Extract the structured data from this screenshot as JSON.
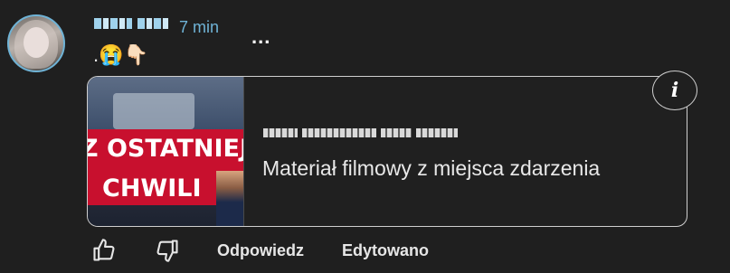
{
  "comment": {
    "time": "7 min",
    "more_label": "...",
    "emojis": ".😭👇🏻"
  },
  "link_card": {
    "thumbnail_text_line1": "Z OSTATNIEJ",
    "thumbnail_text_line2": "CHWILI",
    "title": "Materiał filmowy z miejsca zdarzenia",
    "info_label": "i"
  },
  "actions": {
    "reply_label": "Odpowiedz",
    "edited_label": "Edytowano"
  },
  "icons": {
    "avatar": "avatar",
    "like": "thumbs-up-icon",
    "dislike": "thumbs-down-icon",
    "info": "info-icon"
  },
  "colors": {
    "background": "#1f1f1f",
    "accent": "#6fb3d6",
    "banner_red": "#c8102e"
  }
}
